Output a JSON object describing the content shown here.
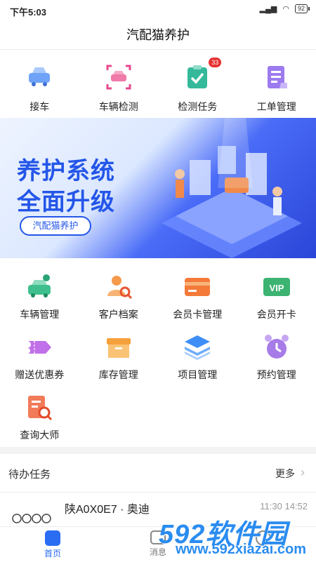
{
  "status": {
    "time": "下午5:03",
    "battery": "92"
  },
  "title": "汽配猫养护",
  "top_actions": [
    {
      "label": "接车",
      "icon": "car-icon"
    },
    {
      "label": "车辆检测",
      "icon": "car-scan-icon"
    },
    {
      "label": "检测任务",
      "icon": "clipboard-check-icon",
      "badge": "33"
    },
    {
      "label": "工单管理",
      "icon": "document-icon"
    }
  ],
  "banner": {
    "line1": "养护系统",
    "line2": "全面升级",
    "pill": "汽配猫养护"
  },
  "grid": [
    {
      "label": "车辆管理",
      "icon": "car-gear-icon"
    },
    {
      "label": "客户档案",
      "icon": "user-search-icon"
    },
    {
      "label": "会员卡管理",
      "icon": "card-icon"
    },
    {
      "label": "会员开卡",
      "icon": "vip-icon"
    },
    {
      "label": "赠送优惠券",
      "icon": "coupon-icon"
    },
    {
      "label": "库存管理",
      "icon": "box-icon"
    },
    {
      "label": "项目管理",
      "icon": "layers-icon"
    },
    {
      "label": "预约管理",
      "icon": "alarm-icon"
    },
    {
      "label": "查询大师",
      "icon": "search-doc-icon"
    }
  ],
  "todo": {
    "title": "待办任务",
    "more": "更多"
  },
  "task": {
    "plate": "陕A0X0E7 · 奥迪",
    "time": "11:30 14:52"
  },
  "tabs": [
    {
      "label": "首页",
      "active": true
    },
    {
      "label": "消息",
      "active": false
    },
    {
      "label": "",
      "active": false
    }
  ],
  "watermark": {
    "brand": "592软件园",
    "url": "www.592xiazai.com"
  }
}
